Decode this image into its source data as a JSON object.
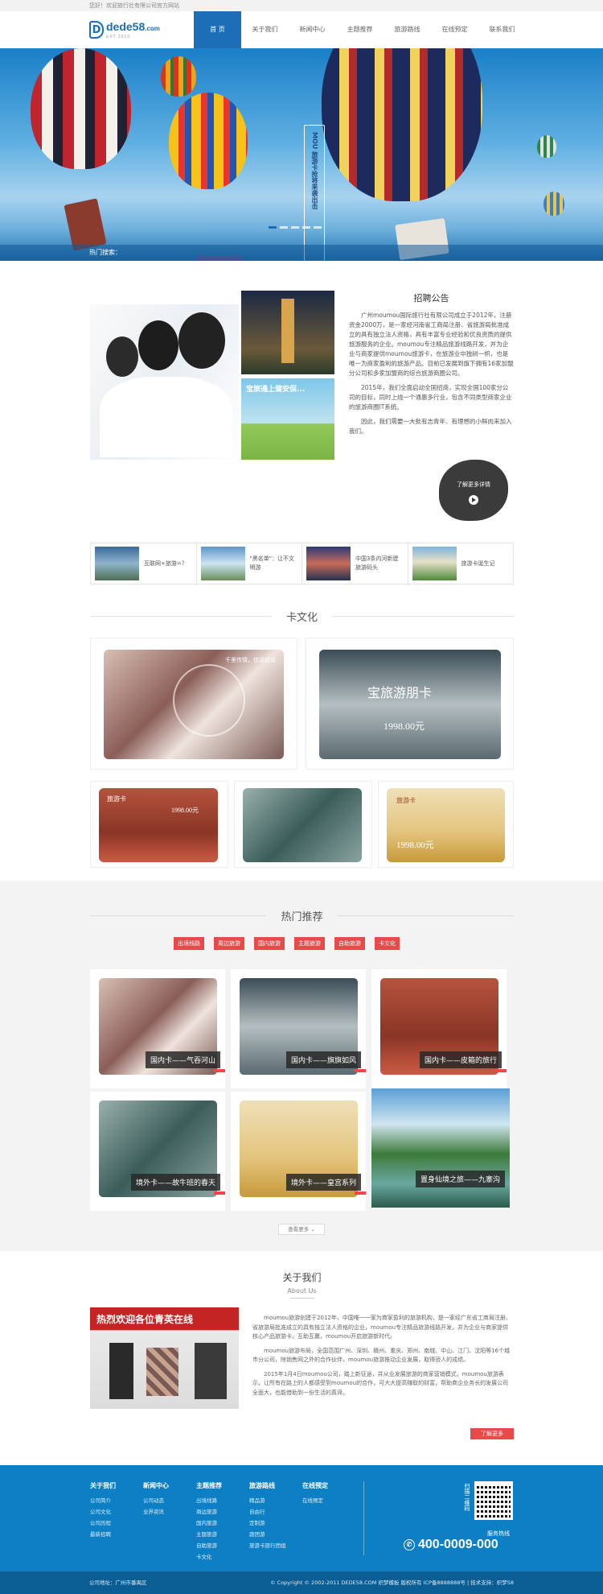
{
  "topbar": {
    "welcome": "您好！欢迎旅行社有限公司官方网站"
  },
  "logo": {
    "mark": "D",
    "name": "dede58",
    "suffix": ".com",
    "tagline": "EST 2010"
  },
  "nav": [
    "首 页",
    "关于我们",
    "新闻中心",
    "主题推荐",
    "旅游路线",
    "在线预定",
    "联系我们"
  ],
  "banner": {
    "vertical_text": "MOU 旅游卡抢将来袭出击",
    "hot_search_label": "热门搜索："
  },
  "notice": {
    "title": "招聘公告",
    "paragraphs": [
      "广州moumou国际旅行社有限公司成立于2012年，注册资金2000万，是一家经河南省工商局注册、省旅游局批准成立的具有独立法人资格，具有丰富专业经验和优良资质的提供旅游服务的企业。moumou专注精品旅游线路开发，并为企业与商家提供moumou旅游卡，在旅游业中独树一帜，也是唯一为商家盈利的旅游产品。目前已发展到旗下拥有16家加盟分公司和多家加盟商的综合旅游商圈公司。",
      "2015年，我们全面启动全国招商，实现全国100家分公司的目标，同时上线一个通惠多行业，包含不同类型商家企业的旅游商圈IT系统。",
      "因此，我们需要一大批有志青年、有理想的小鲜肉来加入我们。"
    ],
    "image_caption": "宝旅通上健安保...",
    "more_label": "了解更多详情"
  },
  "news": [
    {
      "title": "互联网+旅游=？"
    },
    {
      "title": "\"黑名单\"：让不文明游"
    },
    {
      "title": "中国3条内河新建旅游码头"
    },
    {
      "title": "旅游卡诞生记"
    }
  ],
  "card_culture": {
    "title": "卡文化",
    "cards": [
      {
        "label": "千里传情，佳话佳话",
        "price": ""
      },
      {
        "label": "宝旅游朋卡",
        "price": "1998.00元"
      },
      {
        "label": "旅游卡",
        "price": "1998.00元"
      },
      {
        "label": "",
        "price": ""
      },
      {
        "label": "旅游卡",
        "price": "1998.00元"
      }
    ]
  },
  "hot": {
    "title": "热门推荐",
    "tags": [
      "出境线路",
      "周边旅游",
      "国内旅游",
      "主题旅游",
      "自助旅游",
      "卡文化"
    ],
    "items": [
      {
        "caption": "国内卡——气吞河山"
      },
      {
        "caption": "国内卡——旗旗如风"
      },
      {
        "caption": "国内卡——皮箱的旅行"
      },
      {
        "caption": "境外卡——故牛班的春天"
      },
      {
        "caption": "境外卡——皇宫系列"
      },
      {
        "caption": "置身仙境之旅——九寨沟"
      }
    ],
    "look_more": "查看更多"
  },
  "about": {
    "title": "关于我们",
    "subtitle": "About Us",
    "banner_text": "热烈欢迎各位青英在线",
    "paragraphs": [
      "moumou旅游创建于2012年，中国唯一一家为商家盈利的旅游机构，是一家经广东省工商局注册、省旅游局批准成立的具有独立法人资格的企业，moumou专注精品旅游线路开发，并为企业与商家提供核心产品旅游卡，互助互赢，moumou开启旅游新时代。",
      "moumou旅游布局，全国范围广州、深圳、赣州、重庆、郑州、南城、中山、江门、沈阳等16个城市分公司，除销售网之外的合作伙伴，moumou旅游推动企业发展，取得骄人的成绩。",
      "2015年1月4日moumou公司，踏上新征途，并从业发展旅游的商家营销模式，moumou旅游表示，让所有在路上的人都感受到moumou的合作，可大大提高赚取的财富，帮助商企业务长的发展公司全面大，也能借助到一份生活的真谛。"
    ],
    "more": "了解更多"
  },
  "footer": {
    "columns": [
      {
        "title": "关于我们",
        "items": [
          "公司简介",
          "公司文化",
          "公司历程",
          "最新招聘"
        ]
      },
      {
        "title": "新闻中心",
        "items": [
          "公司动态",
          "业界资讯"
        ]
      },
      {
        "title": "主题推荐",
        "items": [
          "出境线路",
          "周边旅游",
          "国内旅游",
          "主题旅游",
          "自助旅游",
          "卡文化"
        ]
      },
      {
        "title": "旅游路线",
        "items": [
          "精品游",
          "自由行",
          "定制游",
          "跟团游",
          "旅游卡旅行团组"
        ]
      },
      {
        "title": "在线预定",
        "items": [
          "在线预定"
        ]
      }
    ],
    "qr_label": "扫描二维码",
    "hotline_label": "服务热线",
    "hotline": "400-0009-000"
  },
  "copyright": {
    "address": "公司地址：广州市番禺区",
    "text": "© Copyright © 2002-2011 DEDE58.COM 织梦模板 版权所有 ICP备8888888号 | 技术支持：织梦58"
  },
  "colors": {
    "primary": "#1c6fb6",
    "accent": "#e84a4a",
    "footer": "#0c7fc5"
  }
}
